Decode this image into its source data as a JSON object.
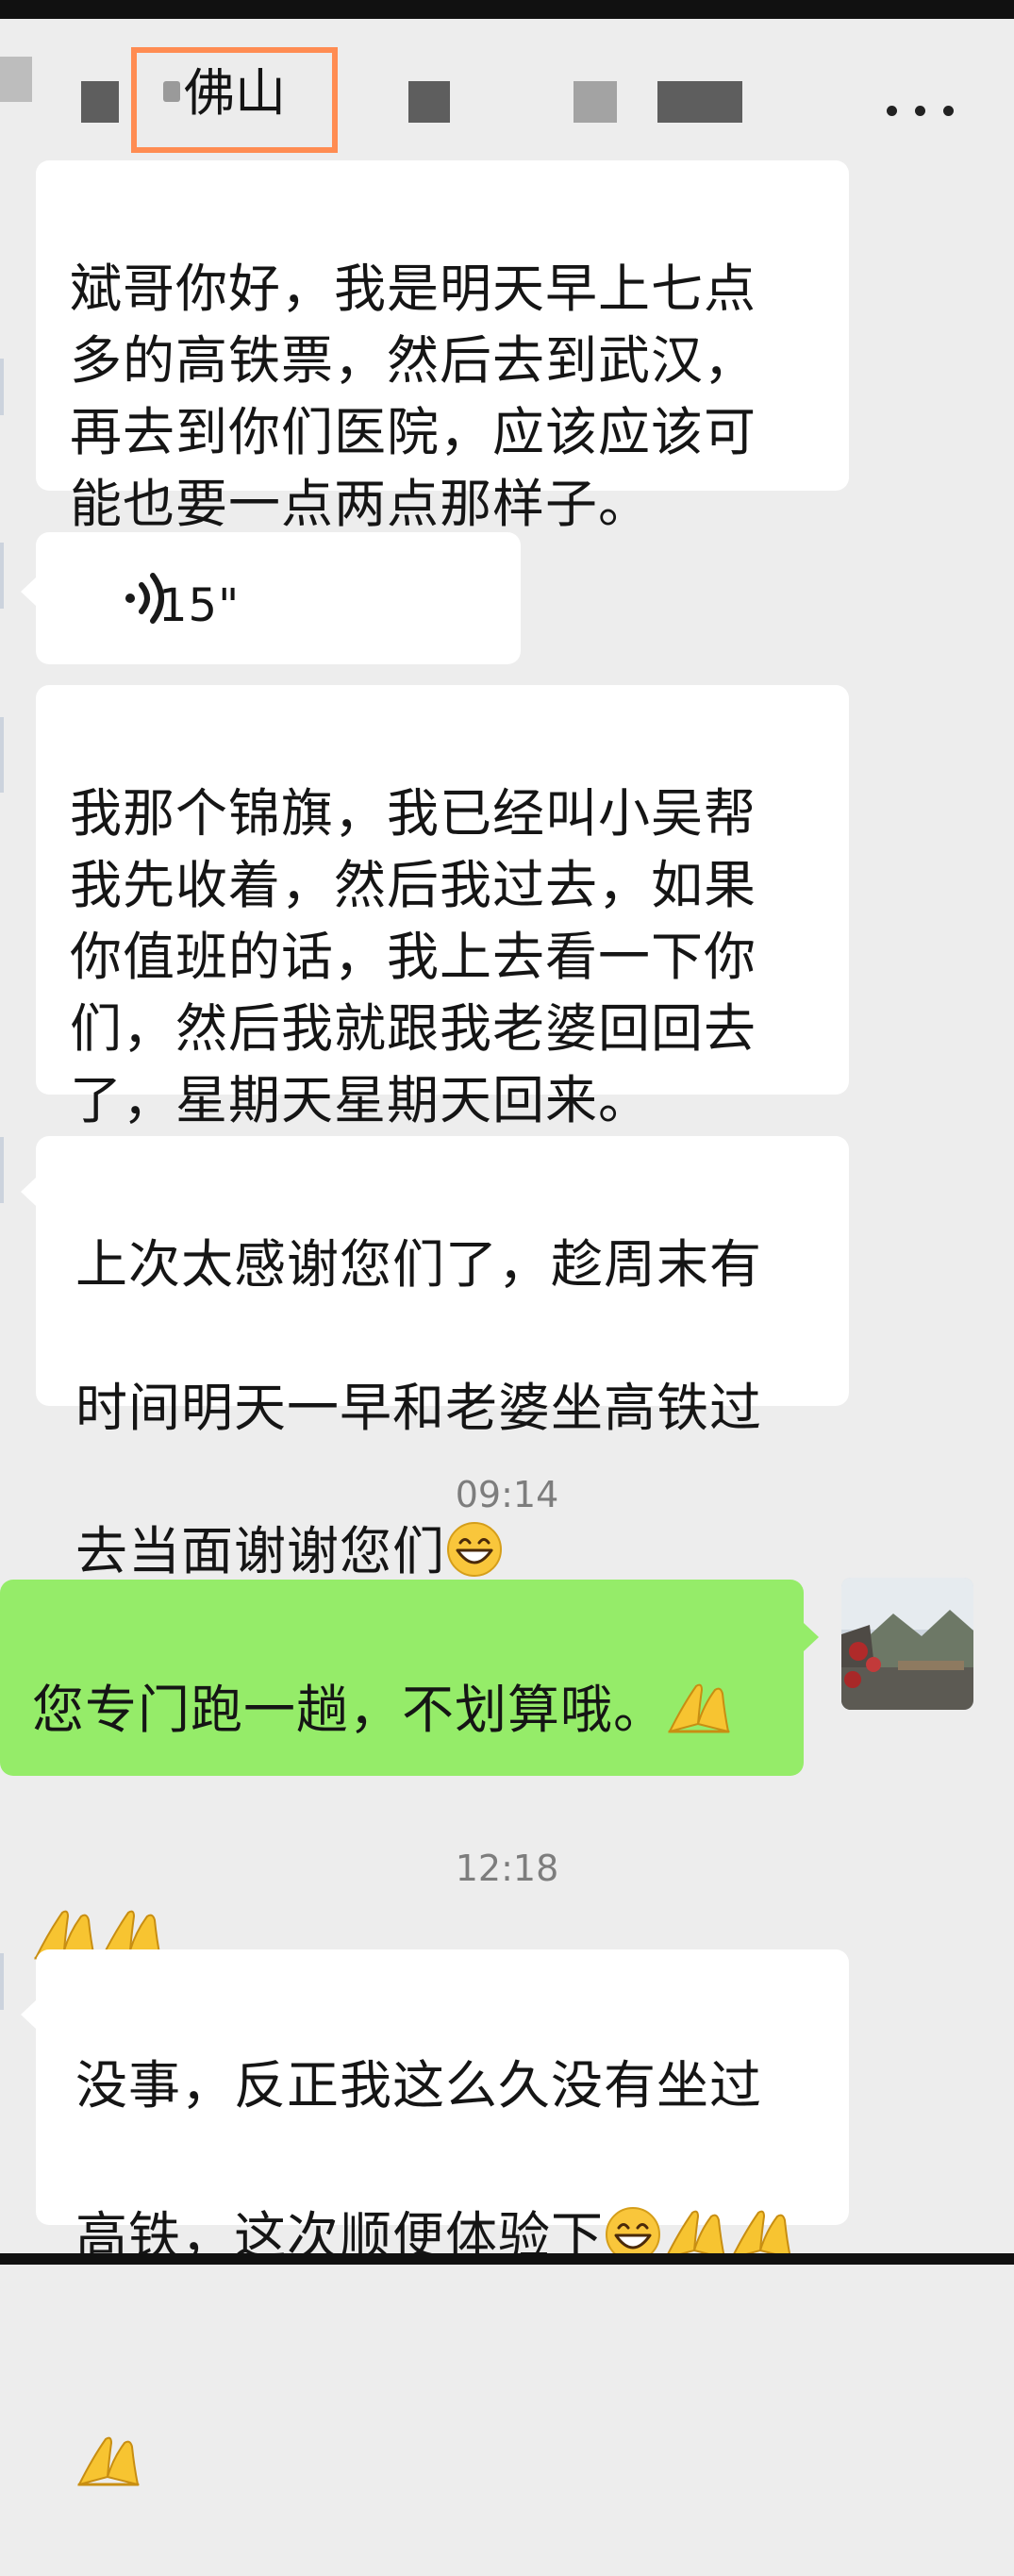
{
  "header": {
    "title": "佛山",
    "more_icon": "more-horizontal-icon",
    "highlight_color": "#ff8c52"
  },
  "messages": [
    {
      "side": "left",
      "type": "text",
      "text": "斌哥你好，我是明天早上七点\n多的高铁票，然后去到武汉，\n再去到你们医院，应该应该可\n能也要一点两点那样子。"
    },
    {
      "side": "left",
      "type": "voice",
      "icon": "voice-wave-icon",
      "duration": "15\""
    },
    {
      "side": "left",
      "type": "text",
      "text": "我那个锦旗，我已经叫小吴帮\n我先收着，然后我过去，如果\n你值班的话，我上去看一下你\n们，然后我就跟我老婆回回去\n了，星期天星期天回来。"
    },
    {
      "side": "left",
      "type": "text",
      "lines": [
        "上次太感谢您们了，趁周末有",
        "时间明天一早和老婆坐高铁过",
        "去当面谢谢您们"
      ],
      "emoji": "grinning-face-emoji"
    },
    {
      "type": "time",
      "text": "09:14"
    },
    {
      "side": "right",
      "type": "text",
      "lines": [
        "您专门跑一趟，不划算哦。"
      ],
      "emoji": "folded-hands-emoji",
      "bubble_color": "#95ec69"
    },
    {
      "type": "time",
      "text": "12:18"
    },
    {
      "side": "left",
      "type": "text",
      "lines": [
        "没事，反正我这么久没有坐过",
        "高铁，这次顺便体验下"
      ],
      "emoji": "grinning-face-emoji"
    }
  ]
}
